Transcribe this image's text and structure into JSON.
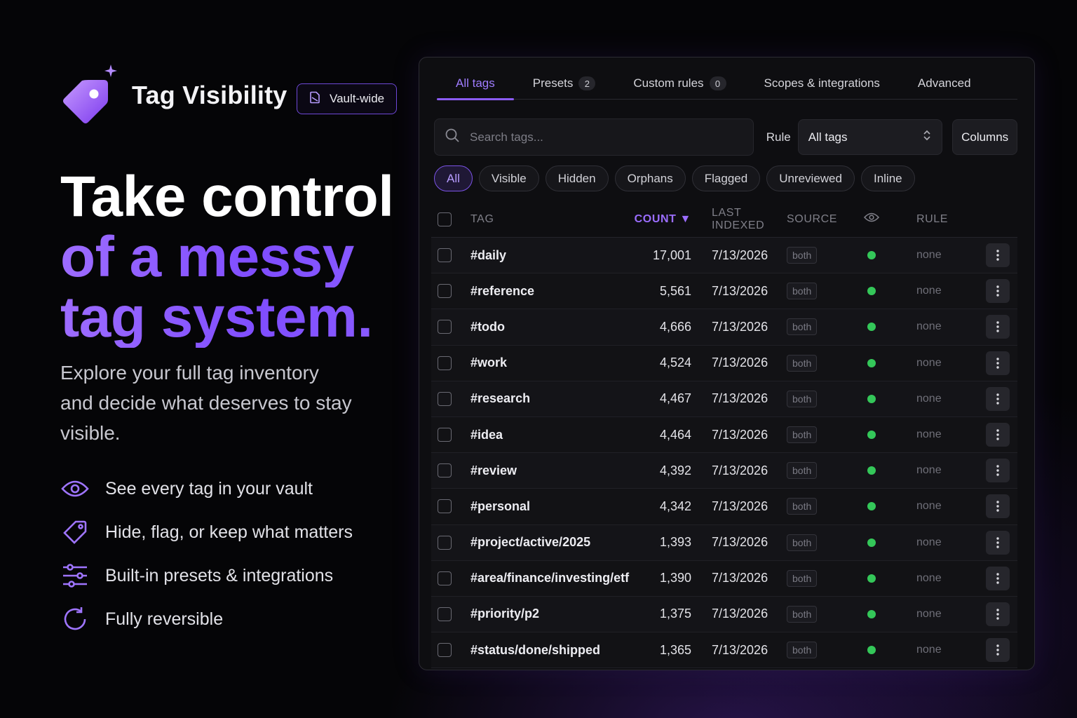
{
  "brand": {
    "title": "Tag Visibility",
    "scope_label": "Vault-wide",
    "accent": "#8b5cf6"
  },
  "hero": {
    "line1": "Take control",
    "line2": "of a messy",
    "line3": "tag system.",
    "subtitle": "Explore your full tag inventory and decide what deserves to stay visible."
  },
  "features": [
    {
      "icon": "eye-icon",
      "label": "See every tag in your vault"
    },
    {
      "icon": "tag-icon",
      "label": "Hide, flag, or keep what matters"
    },
    {
      "icon": "sliders-icon",
      "label": "Built-in presets & integrations"
    },
    {
      "icon": "refresh-icon",
      "label": "Fully reversible"
    }
  ],
  "tabs": [
    {
      "label": "All tags",
      "badge": null,
      "active": true
    },
    {
      "label": "Presets",
      "badge": "2"
    },
    {
      "label": "Custom rules",
      "badge": "0"
    },
    {
      "label": "Scopes & integrations",
      "badge": null
    },
    {
      "label": "Advanced",
      "badge": null
    }
  ],
  "toolbar": {
    "search_placeholder": "Search tags...",
    "rule_label": "Rule",
    "rule_value": "All tags",
    "columns_label": "Columns"
  },
  "filters": [
    "All",
    "Visible",
    "Hidden",
    "Orphans",
    "Flagged",
    "Unreviewed",
    "Inline"
  ],
  "table": {
    "headers": {
      "tag": "TAG",
      "count": "COUNT ▼",
      "last_indexed": "LAST INDEXED",
      "source": "SOURCE",
      "rule": "RULE"
    },
    "rows": [
      {
        "tag": "#daily",
        "count": "17,001",
        "date": "7/13/2026",
        "source": "both",
        "visible": true,
        "rule": "none"
      },
      {
        "tag": "#reference",
        "count": "5,561",
        "date": "7/13/2026",
        "source": "both",
        "visible": true,
        "rule": "none"
      },
      {
        "tag": "#todo",
        "count": "4,666",
        "date": "7/13/2026",
        "source": "both",
        "visible": true,
        "rule": "none"
      },
      {
        "tag": "#work",
        "count": "4,524",
        "date": "7/13/2026",
        "source": "both",
        "visible": true,
        "rule": "none"
      },
      {
        "tag": "#research",
        "count": "4,467",
        "date": "7/13/2026",
        "source": "both",
        "visible": true,
        "rule": "none"
      },
      {
        "tag": "#idea",
        "count": "4,464",
        "date": "7/13/2026",
        "source": "both",
        "visible": true,
        "rule": "none"
      },
      {
        "tag": "#review",
        "count": "4,392",
        "date": "7/13/2026",
        "source": "both",
        "visible": true,
        "rule": "none"
      },
      {
        "tag": "#personal",
        "count": "4,342",
        "date": "7/13/2026",
        "source": "both",
        "visible": true,
        "rule": "none"
      },
      {
        "tag": "#project/active/2025",
        "count": "1,393",
        "date": "7/13/2026",
        "source": "both",
        "visible": true,
        "rule": "none"
      },
      {
        "tag": "#area/finance/investing/etf",
        "count": "1,390",
        "date": "7/13/2026",
        "source": "both",
        "visible": true,
        "rule": "none"
      },
      {
        "tag": "#priority/p2",
        "count": "1,375",
        "date": "7/13/2026",
        "source": "both",
        "visible": true,
        "rule": "none"
      },
      {
        "tag": "#status/done/shipped",
        "count": "1,365",
        "date": "7/13/2026",
        "source": "both",
        "visible": true,
        "rule": "none"
      }
    ]
  }
}
